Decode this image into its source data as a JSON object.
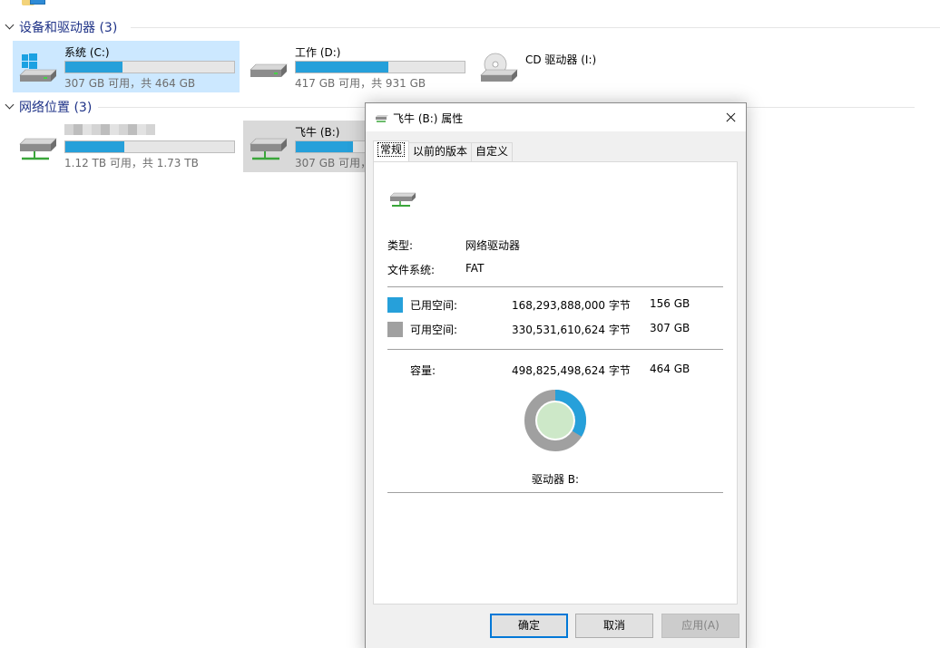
{
  "explorer": {
    "groups": [
      {
        "label": "设备和驱动器 (3)"
      },
      {
        "label": "网络位置 (3)"
      }
    ],
    "drives": [
      {
        "name": "系统 (C:)",
        "info": "307 GB 可用，共 464 GB",
        "used_fraction": 0.34,
        "icon": "windows-drive-icon"
      },
      {
        "name": "工作 (D:)",
        "info": "417 GB 可用，共 931 GB",
        "used_fraction": 0.55,
        "icon": "hard-drive-icon"
      },
      {
        "name": "CD 驱动器 (I:)",
        "icon": "cd-drive-icon"
      }
    ],
    "network": [
      {
        "info": "1.12 TB 可用，共 1.73 TB",
        "used_fraction": 0.35,
        "icon": "network-drive-icon"
      },
      {
        "name": "飞牛 (B:)",
        "info": "307 GB 可用，",
        "used_fraction": 0.34,
        "icon": "network-drive-icon"
      }
    ]
  },
  "dialog": {
    "title": "飞牛 (B:) 属性",
    "tabs": [
      "常规",
      "以前的版本",
      "自定义"
    ],
    "type_label": "类型:",
    "type_value": "网络驱动器",
    "fs_label": "文件系统:",
    "fs_value": "FAT",
    "used_label": "已用空间:",
    "used_bytes": "168,293,888,000 字节",
    "used_size": "156 GB",
    "free_label": "可用空间:",
    "free_bytes": "330,531,610,624 字节",
    "free_size": "307 GB",
    "capacity_label": "容量:",
    "capacity_bytes": "498,825,498,624 字节",
    "capacity_size": "464 GB",
    "drive_label": "驱动器 B:",
    "used_fraction": 0.337,
    "buttons": {
      "ok": "确定",
      "cancel": "取消",
      "apply": "应用(A)"
    }
  },
  "colors": {
    "used": "#26a0da",
    "free": "#a0a0a0",
    "donut_center": "#cde8c8",
    "selection": "#cce8ff"
  }
}
